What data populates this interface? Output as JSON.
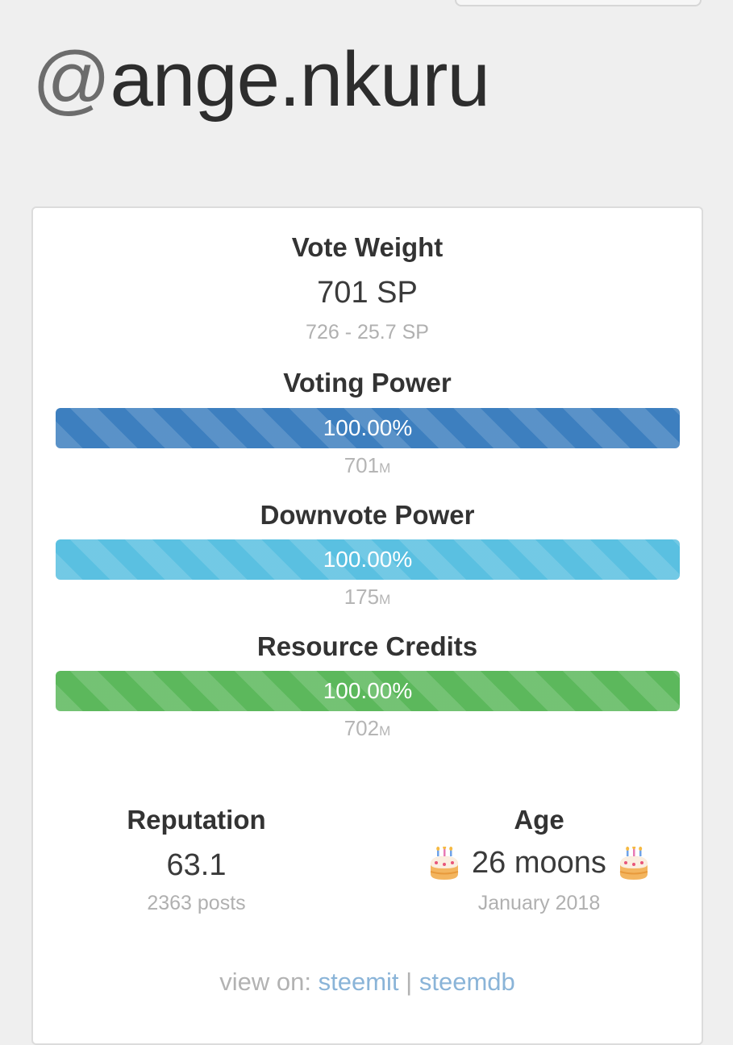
{
  "header": {
    "at_symbol": "@",
    "username": "ange.nkuru"
  },
  "vote_weight": {
    "title": "Vote Weight",
    "value": "701 SP",
    "detail": "726 - 25.7 SP"
  },
  "voting_power": {
    "title": "Voting Power",
    "percent_label": "100.00%",
    "percent": 100,
    "mana_value": "701",
    "mana_unit": "M",
    "color": "#3d7fbf"
  },
  "downvote_power": {
    "title": "Downvote Power",
    "percent_label": "100.00%",
    "percent": 100,
    "mana_value": "175",
    "mana_unit": "M",
    "color": "#5ac0e1"
  },
  "resource_credits": {
    "title": "Resource Credits",
    "percent_label": "100.00%",
    "percent": 100,
    "mana_value": "702",
    "mana_unit": "M",
    "color": "#5cb85c"
  },
  "reputation": {
    "title": "Reputation",
    "value": "63.1",
    "posts": "2363 posts"
  },
  "age": {
    "title": "Age",
    "value": "26 moons",
    "since": "January 2018",
    "icon": "birthday-cake-icon"
  },
  "footer": {
    "prefix": "view on:",
    "link_steemit": "steemit",
    "separator": "|",
    "link_steemdb": "steemdb"
  }
}
